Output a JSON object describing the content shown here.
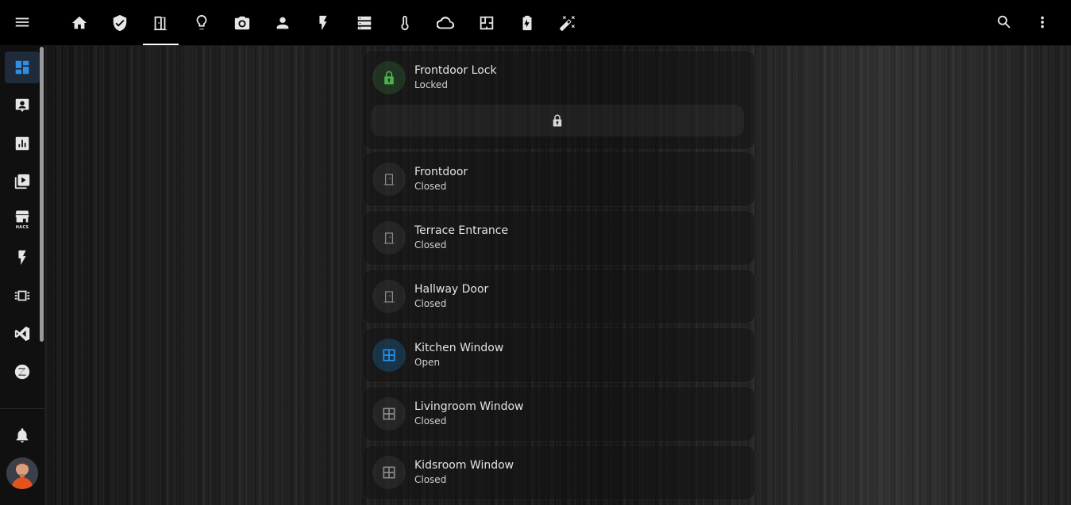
{
  "header": {
    "menu_icon": "menu-icon",
    "tabs": [
      {
        "icon": "home-icon",
        "active": false
      },
      {
        "icon": "shield-check-icon",
        "active": false
      },
      {
        "icon": "door-open-icon",
        "active": true
      },
      {
        "icon": "lightbulb-icon",
        "active": false
      },
      {
        "icon": "camera-icon",
        "active": false
      },
      {
        "icon": "account-icon",
        "active": false
      },
      {
        "icon": "flash-icon",
        "active": false
      },
      {
        "icon": "server-icon",
        "active": false
      },
      {
        "icon": "thermometer-icon",
        "active": false
      },
      {
        "icon": "cloud-icon",
        "active": false
      },
      {
        "icon": "floor-plan-icon",
        "active": false
      },
      {
        "icon": "battery-charging-icon",
        "active": false
      },
      {
        "icon": "magic-wand-icon",
        "active": false
      }
    ],
    "actions": [
      "search-icon",
      "dots-vertical-icon"
    ]
  },
  "sidebar": {
    "items": [
      {
        "icon": "dashboard-icon",
        "active": true
      },
      {
        "icon": "account-box-icon",
        "active": false
      },
      {
        "icon": "chart-box-icon",
        "active": false
      },
      {
        "icon": "media-icon",
        "active": false
      },
      {
        "icon": "hacs-icon",
        "active": false,
        "label": "HACS"
      },
      {
        "icon": "energy-icon",
        "active": false
      },
      {
        "icon": "memory-chip-icon",
        "active": false
      },
      {
        "icon": "vscode-icon",
        "active": false
      },
      {
        "icon": "zigbee-icon",
        "active": false
      }
    ],
    "bell_icon": "bell-icon"
  },
  "cards": {
    "lock": {
      "name": "Frontdoor Lock",
      "state": "Locked",
      "color": "#4caf50"
    },
    "entities": [
      {
        "name": "Frontdoor",
        "state": "Closed",
        "type": "door"
      },
      {
        "name": "Terrace Entrance",
        "state": "Closed",
        "type": "door"
      },
      {
        "name": "Hallway Door",
        "state": "Closed",
        "type": "door"
      },
      {
        "name": "Kitchen Window",
        "state": "Open",
        "type": "window-open"
      },
      {
        "name": "Livingroom Window",
        "state": "Closed",
        "type": "window"
      },
      {
        "name": "Kidsroom Window",
        "state": "Closed",
        "type": "window"
      }
    ]
  },
  "colors": {
    "accent": "#2f8fe6",
    "open": "#2196f3",
    "lock": "#4caf50"
  }
}
